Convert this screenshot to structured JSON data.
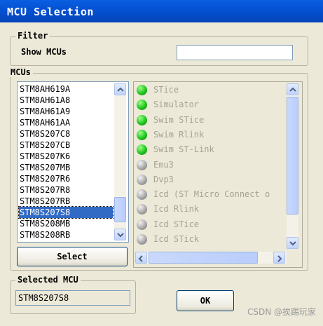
{
  "window": {
    "title": "MCU Selection"
  },
  "filter": {
    "legend": "Filter",
    "show_label": "Show MCUs",
    "value": "",
    "placeholder": ""
  },
  "mcus": {
    "legend": "MCUs",
    "items": [
      "STM8AH619A",
      "STM8AH61A8",
      "STM8AH61A9",
      "STM8AH61AA",
      "STM8S207C8",
      "STM8S207CB",
      "STM8S207K6",
      "STM8S207MB",
      "STM8S207R6",
      "STM8S207R8",
      "STM8S207RB",
      "STM8S207S8",
      "STM8S208MB",
      "STM8S208RB"
    ],
    "selected": "STM8S207S8"
  },
  "select_button": "Select",
  "probes": [
    {
      "name": "STice",
      "status": "green"
    },
    {
      "name": "Simulator",
      "status": "green"
    },
    {
      "name": "Swim STice",
      "status": "green"
    },
    {
      "name": "Swim Rlink",
      "status": "green"
    },
    {
      "name": "Swim ST-Link",
      "status": "green"
    },
    {
      "name": "Emu3",
      "status": "gray"
    },
    {
      "name": "Dvp3",
      "status": "gray"
    },
    {
      "name": "Icd (ST Micro Connect o",
      "status": "gray"
    },
    {
      "name": "Icd Rlink",
      "status": "gray"
    },
    {
      "name": "Icd STice",
      "status": "gray"
    },
    {
      "name": "Icd STick",
      "status": "gray"
    }
  ],
  "selected_mcu": {
    "legend": "Selected MCU",
    "value": "STM8S207S8"
  },
  "ok_button": "OK",
  "watermark": "CSDN @挨踢玩家",
  "colors": {
    "title_bar": "#0452d4",
    "selection": "#316ac5",
    "active_probe": "#1ec61e",
    "inactive_probe": "#a9a9a9"
  }
}
